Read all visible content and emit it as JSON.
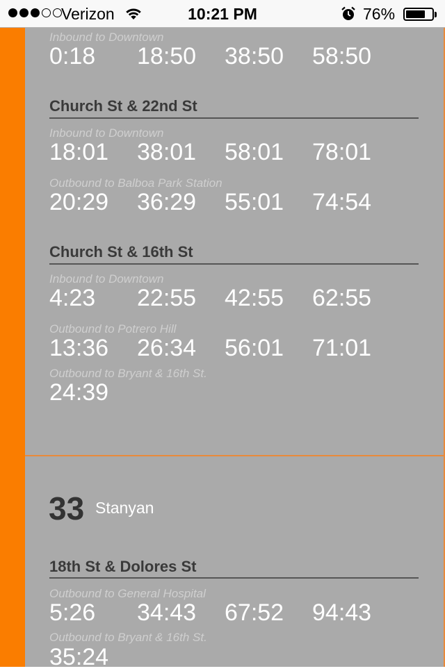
{
  "status_bar": {
    "signal_bars_filled": 3,
    "signal_bars_total": 5,
    "carrier": "Verizon",
    "time": "10:21 PM",
    "battery_percent": "76%",
    "battery_level": 0.76
  },
  "colors": {
    "accent": "#fa7d00",
    "card": "#aaaaaa"
  },
  "card1": {
    "top_direction": {
      "label": "Inbound to Downtown",
      "times": [
        "0:18",
        "18:50",
        "38:50",
        "58:50"
      ]
    },
    "stops": [
      {
        "name": "Church St & 22nd St",
        "directions": [
          {
            "label": "Inbound to Downtown",
            "times": [
              "18:01",
              "38:01",
              "58:01",
              "78:01"
            ]
          },
          {
            "label": "Outbound to Balboa Park Station",
            "times": [
              "20:29",
              "36:29",
              "55:01",
              "74:54"
            ]
          }
        ]
      },
      {
        "name": "Church St & 16th St",
        "directions": [
          {
            "label": "Inbound to Downtown",
            "times": [
              "4:23",
              "22:55",
              "42:55",
              "62:55"
            ]
          },
          {
            "label": "Outbound to Potrero Hill",
            "times": [
              "13:36",
              "26:34",
              "56:01",
              "71:01"
            ]
          },
          {
            "label": "Outbound to Bryant & 16th St.",
            "times": [
              "24:39"
            ]
          }
        ]
      }
    ]
  },
  "card2": {
    "route_number": "33",
    "route_name": "Stanyan",
    "stops": [
      {
        "name": "18th St & Dolores St",
        "directions": [
          {
            "label": "Outbound to General Hospital",
            "times": [
              "5:26",
              "34:43",
              "67:52",
              "94:43"
            ]
          },
          {
            "label": "Outbound to Bryant & 16th St.",
            "times": [
              "35:24"
            ]
          }
        ]
      }
    ]
  }
}
